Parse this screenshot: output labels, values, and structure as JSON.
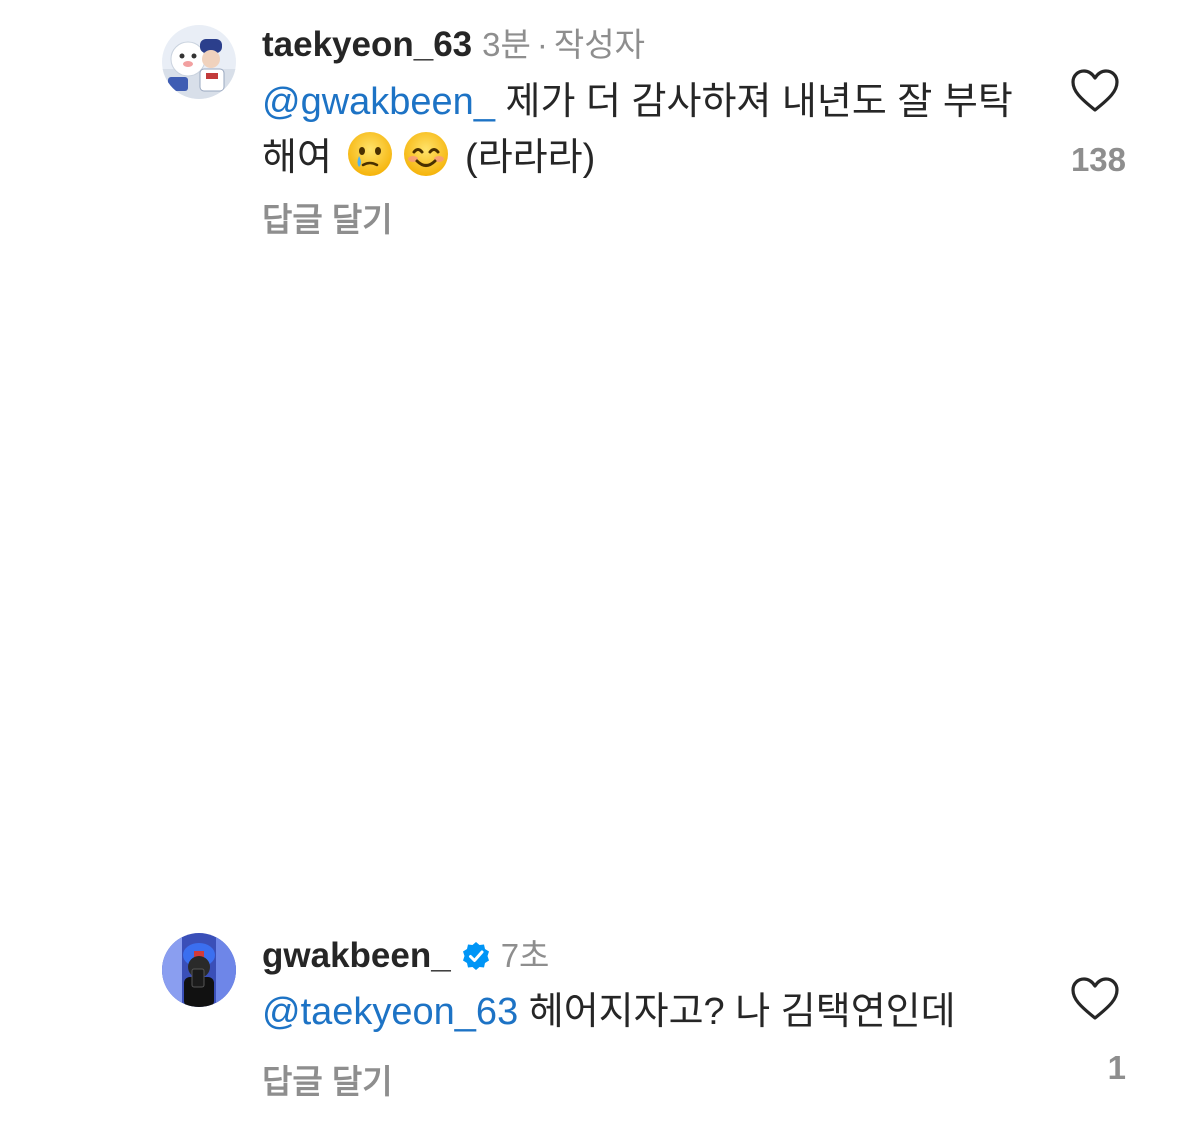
{
  "comments": [
    {
      "username": "taekyeon_63",
      "time": "3분",
      "separator": "·",
      "author_badge": "작성자",
      "mention": "@gwakbeen_",
      "text": " 제가 더 감사하져 내년도 잘 부탁해여 ",
      "text_after_emoji": " (라라라)",
      "emojis": [
        "holding-back-tears-emoji",
        "smiling-face-emoji"
      ],
      "reply_label": "답글 달기",
      "like_count": "138",
      "avatar": "profile-photo-mascot"
    },
    {
      "username": "gwakbeen_",
      "verified": true,
      "time": "7초",
      "mention": "@taekyeon_63",
      "text": " 헤어지자고? 나 김택연인데",
      "reply_label": "답글 달기",
      "like_count": "1",
      "avatar": "profile-photo-mirror-selfie"
    }
  ],
  "colors": {
    "mention": "#1d73c5",
    "secondary": "#8e8e8e",
    "primary_text": "#262626",
    "verified_badge": "#0095f6"
  },
  "icons": [
    "heart-icon",
    "verified-badge-icon"
  ]
}
